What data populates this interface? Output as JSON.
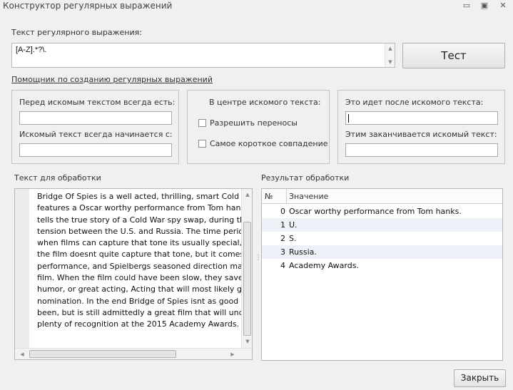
{
  "window": {
    "title": "Конструктор регулярных выражений",
    "minimize_glyph": "▭",
    "restore_glyph": "▣",
    "close_glyph": "✕"
  },
  "regex": {
    "label": "Текст регулярного выражения:",
    "value": "[A-Z].*?\\.",
    "test_button": "Тест"
  },
  "helper_link": "Помощник по созданию регулярных выражений",
  "groups": {
    "before": {
      "before_label": "Перед искомым текстом всегда есть:",
      "starts_label": "Искомый текст всегда начинается с:"
    },
    "center": {
      "title": "В центре искомого текста:",
      "allow_wrap": "Разрешить переносы",
      "shortest_match": "Самое короткое совпадение"
    },
    "after": {
      "after_label": "Это идет после искомого текста:",
      "ends_label": "Этим заканчивается искомый текст:"
    }
  },
  "input_section": {
    "label": "Текст для обработки",
    "lines": [
      "Bridge Of Spies is a well acted, thrilling, smart Cold War dra",
      "features a Oscar worthy performance from Tom hanks. Bric",
      "tells the true story of a Cold War spy swap, during the heig",
      "tension between the U.S. and Russia. The time period was",
      "when films can capture that tone its usually special, that be",
      "the film doesnt quite capture that tone, but it comes close.",
      "performance, and Spielbergs seasoned direction manage to",
      "film. When the film could have been slow, they save it by u",
      "humor, or great acting, Acting that will most likely get Hank",
      "nomination. In the end Bridge of Spies isnt as good as it cou",
      "been, but is still admittedly a great film that will undoubtedl",
      "plenty of recognition at the 2015 Academy Awards."
    ]
  },
  "results": {
    "label": "Результат обработки",
    "columns": [
      "№",
      "Значение"
    ],
    "rows": [
      {
        "num": "0",
        "value": "Oscar worthy performance from Tom hanks."
      },
      {
        "num": "1",
        "value": "U."
      },
      {
        "num": "2",
        "value": "S."
      },
      {
        "num": "3",
        "value": "Russia."
      },
      {
        "num": "4",
        "value": "Academy Awards."
      }
    ]
  },
  "footer": {
    "close_button": "Закрыть"
  }
}
